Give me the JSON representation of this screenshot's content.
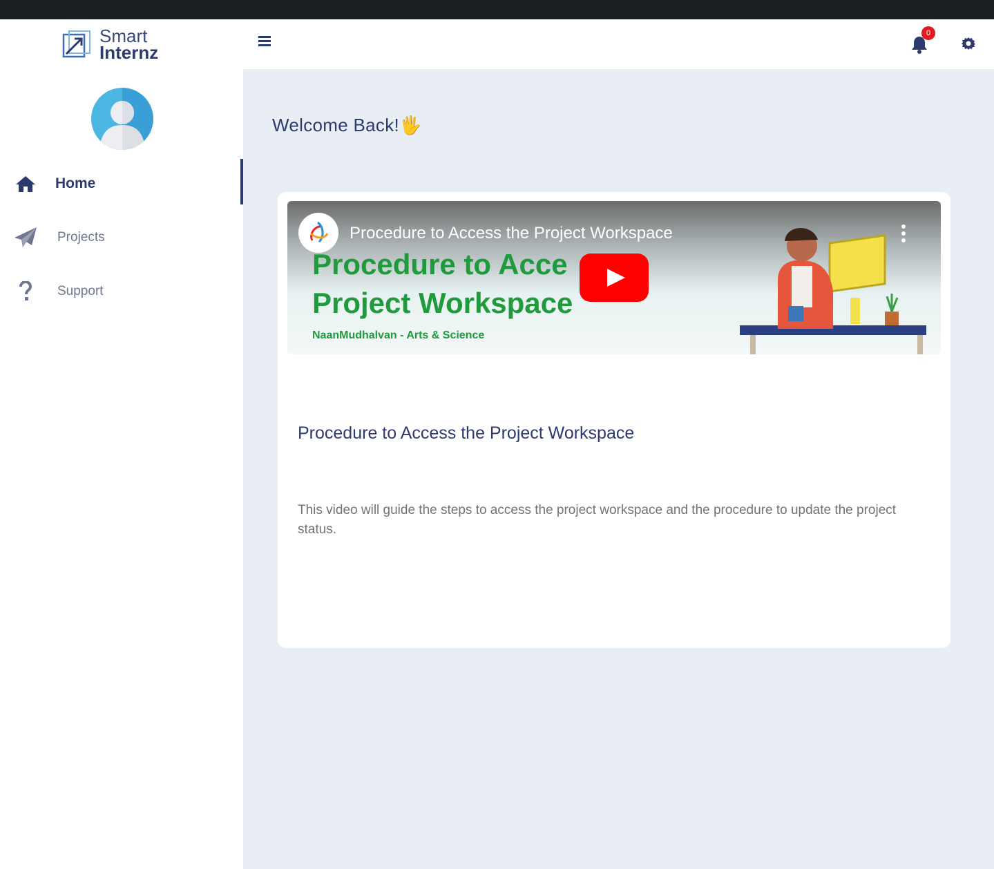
{
  "brand": {
    "line1": "Smart",
    "line2": "Internz"
  },
  "sidebar": {
    "items": [
      {
        "label": "Home",
        "icon": "home-icon",
        "active": true
      },
      {
        "label": "Projects",
        "icon": "paper-plane-icon"
      },
      {
        "label": "Support",
        "icon": "question-icon"
      }
    ]
  },
  "header": {
    "notification_count": "0"
  },
  "main": {
    "welcome": "Welcome Back!",
    "welcome_emoji": "🖐"
  },
  "card": {
    "video": {
      "overlay_title": "Procedure to Access the Project Workspace",
      "thumb_line1": "Procedure to Acce",
      "thumb_line1_end": "e",
      "thumb_line2": "Project Workspace",
      "thumb_sub": "NaanMudhalvan - Arts & Science"
    },
    "title": "Procedure to Access the Project Workspace",
    "description": "This video will guide the steps to access the project workspace and the procedure to update the project status."
  },
  "colors": {
    "primary": "#2d3a6e",
    "background": "#e9eef4",
    "accent_red": "#e21b23",
    "thumb_green": "#1f9a3c"
  }
}
